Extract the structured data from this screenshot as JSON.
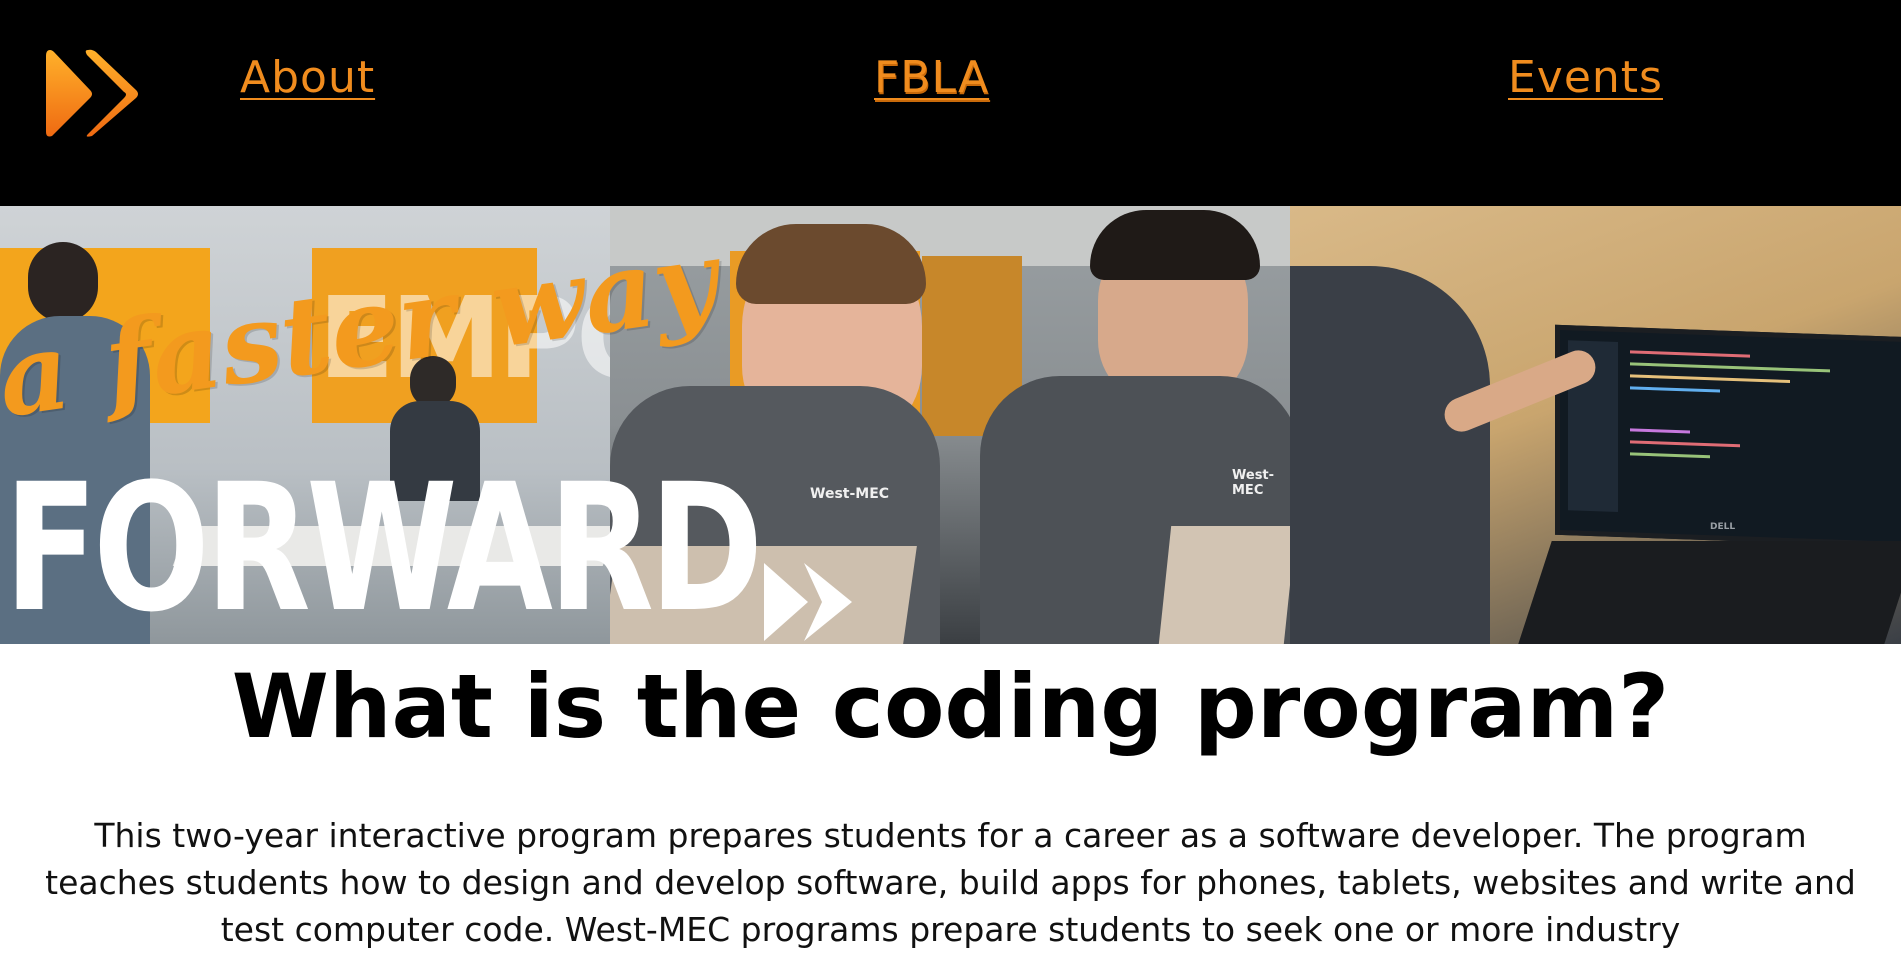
{
  "nav": {
    "logo_icon": "double-chevron-right-icon",
    "links": [
      {
        "label": "About"
      },
      {
        "label": "FBLA"
      },
      {
        "label": "Events"
      }
    ]
  },
  "hero": {
    "tagline_script": "a faster way",
    "tagline_big": "FORWARD",
    "wall_text": "EMPO",
    "shirt_text": "West-MEC",
    "laptop_brand": "DELL"
  },
  "main": {
    "headline": "What is the coding program?",
    "body": "This two-year interactive program prepares students for a career as a software developer. The program teaches students how to design and develop software, build apps for phones, tablets, websites and write and test computer code. West-MEC programs prepare students to seek one or more industry"
  },
  "colors": {
    "nav_background": "#000000",
    "accent_orange": "#f08c1e",
    "page_background": "#ffffff"
  }
}
